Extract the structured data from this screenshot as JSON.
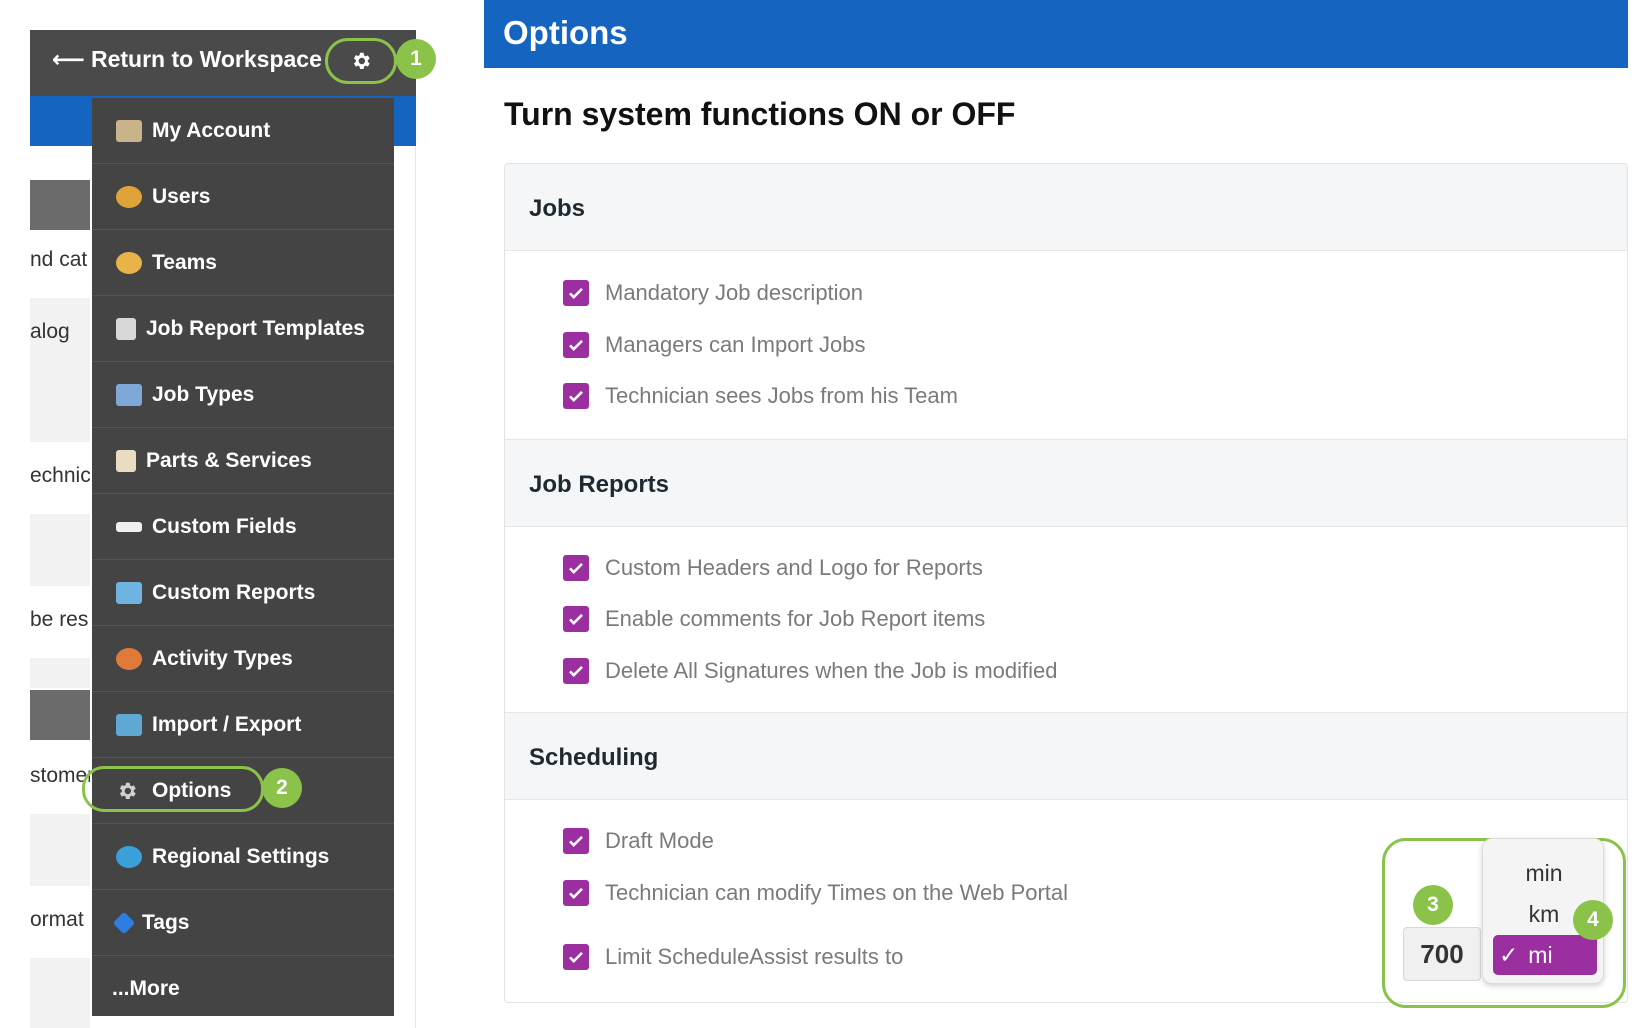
{
  "workspace": {
    "return_label": "Return to Workspace",
    "settings_badge": "1"
  },
  "background_fragments": [
    "nd cat",
    "alog",
    "echnic",
    "be res",
    "stomer",
    "ormat"
  ],
  "menu": {
    "items": [
      {
        "label": "My Account",
        "icon": "id-card-icon"
      },
      {
        "label": "Users",
        "icon": "users-icon"
      },
      {
        "label": "Teams",
        "icon": "teams-icon"
      },
      {
        "label": "Job Report Templates",
        "icon": "report-template-icon"
      },
      {
        "label": "Job Types",
        "icon": "job-types-icon"
      },
      {
        "label": "Parts & Services",
        "icon": "clipboard-icon"
      },
      {
        "label": "Custom Fields",
        "icon": "custom-fields-icon"
      },
      {
        "label": "Custom Reports",
        "icon": "custom-reports-icon"
      },
      {
        "label": "Activity Types",
        "icon": "activity-types-icon"
      },
      {
        "label": "Import / Export",
        "icon": "import-export-icon"
      },
      {
        "label": "Options",
        "icon": "gear-icon"
      },
      {
        "label": "Regional Settings",
        "icon": "globe-icon"
      },
      {
        "label": "Tags",
        "icon": "tag-icon"
      },
      {
        "label": "...More",
        "icon": ""
      }
    ],
    "options_badge": "2"
  },
  "options": {
    "header": "Options",
    "title": "Turn system functions ON or OFF",
    "sections": [
      {
        "name": "Jobs",
        "items": [
          "Mandatory Job description",
          "Managers can Import Jobs",
          "Technician sees Jobs from his Team"
        ]
      },
      {
        "name": "Job Reports",
        "items": [
          "Custom Headers and Logo for Reports",
          "Enable comments for Job Report items",
          "Delete All Signatures when the Job is modified"
        ]
      },
      {
        "name": "Scheduling",
        "items": [
          "Draft Mode",
          "Technician can modify Times on the Web Portal",
          "Limit ScheduleAssist results to"
        ]
      }
    ],
    "limit": {
      "value": "700",
      "units": [
        "min",
        "km",
        "mi"
      ],
      "selected_unit": "mi",
      "value_badge": "3",
      "unit_badge": "4"
    }
  },
  "colors": {
    "primary_blue": "#1565c0",
    "menu_bg": "#444444",
    "checkbox": "#9c2fa0",
    "highlight_green": "#8bc34a"
  }
}
